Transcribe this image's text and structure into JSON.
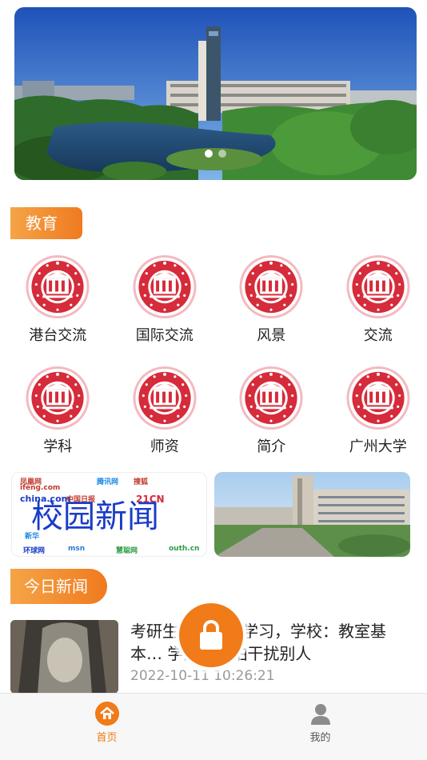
{
  "banner": {
    "image": "campus-tower-lake-photo",
    "dots": 2,
    "active_dot": 0
  },
  "sections": {
    "education_label": "教育",
    "today_news_label": "今日新闻"
  },
  "education_items": [
    {
      "label": "港台交流",
      "icon": "university-seal-icon"
    },
    {
      "label": "国际交流",
      "icon": "university-seal-icon"
    },
    {
      "label": "风景",
      "icon": "university-seal-icon"
    },
    {
      "label": "交流",
      "icon": "university-seal-icon"
    },
    {
      "label": "学科",
      "icon": "university-seal-icon"
    },
    {
      "label": "师资",
      "icon": "university-seal-icon"
    },
    {
      "label": "简介",
      "icon": "university-seal-icon"
    },
    {
      "label": "广州大学",
      "icon": "university-seal-icon"
    }
  ],
  "promo": {
    "news_title": "校园新闻",
    "news_logos": [
      "凤凰网",
      "ifeng.com",
      "腾讯网",
      "搜狐",
      "china.com",
      "中国日报",
      "21CN",
      "新华",
      "环球网",
      "msn",
      "慧聪网",
      "outh.cn"
    ],
    "campus_image": "campus-buildings-photo"
  },
  "article": {
    "title": "考研生自带帐篷学习，学校：教室基本… 学生背书怕干扰别人",
    "time": "2022-10-11 10:26:21"
  },
  "floating": {
    "icon": "lock-icon"
  },
  "tabbar": {
    "items": [
      {
        "label": "首页",
        "icon": "home-icon",
        "active": true
      },
      {
        "label": "我的",
        "icon": "user-icon",
        "active": false
      }
    ]
  },
  "colors": {
    "accent": "#f07b18",
    "seal_red": "#d62b3a",
    "news_blue": "#1a3cc8"
  }
}
